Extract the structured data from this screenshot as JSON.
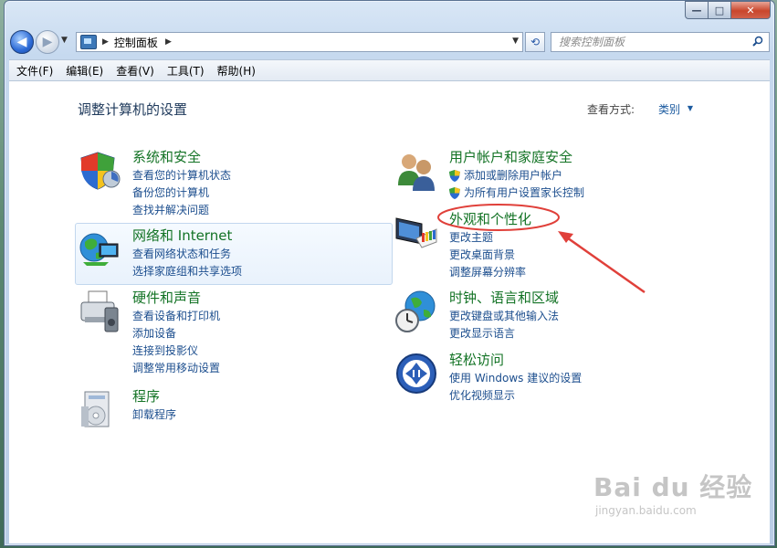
{
  "window": {
    "caption": {
      "minimize": "—",
      "maximize": "□",
      "close": "✕"
    }
  },
  "nav": {
    "back_icon": "arrow-left-icon",
    "forward_icon": "arrow-right-icon",
    "breadcrumb": "控制面板",
    "search_placeholder": "搜索控制面板"
  },
  "menu": [
    "文件(F)",
    "编辑(E)",
    "查看(V)",
    "工具(T)",
    "帮助(H)"
  ],
  "page": {
    "title": "调整计算机的设置",
    "view_by_label": "查看方式:",
    "view_by_value": "类别"
  },
  "categories": {
    "system": {
      "title": "系统和安全",
      "links": [
        "查看您的计算机状态",
        "备份您的计算机",
        "查找并解决问题"
      ]
    },
    "network": {
      "title": "网络和 Internet",
      "links": [
        "查看网络状态和任务",
        "选择家庭组和共享选项"
      ]
    },
    "hardware": {
      "title": "硬件和声音",
      "links": [
        "查看设备和打印机",
        "添加设备",
        "连接到投影仪",
        "调整常用移动设置"
      ]
    },
    "programs": {
      "title": "程序",
      "links": [
        "卸载程序"
      ]
    },
    "users": {
      "title": "用户帐户和家庭安全",
      "links": [
        "添加或删除用户帐户",
        "为所有用户设置家长控制"
      ]
    },
    "appearance": {
      "title": "外观和个性化",
      "links": [
        "更改主题",
        "更改桌面背景",
        "调整屏幕分辨率"
      ]
    },
    "clock": {
      "title": "时钟、语言和区域",
      "links": [
        "更改键盘或其他输入法",
        "更改显示语言"
      ]
    },
    "ease": {
      "title": "轻松访问",
      "links": [
        "使用 Windows 建议的设置",
        "优化视频显示"
      ]
    }
  },
  "annotation_color": "#e0403a",
  "watermark": {
    "brand": "Bai du 经验",
    "url": "jingyan.baidu.com"
  }
}
